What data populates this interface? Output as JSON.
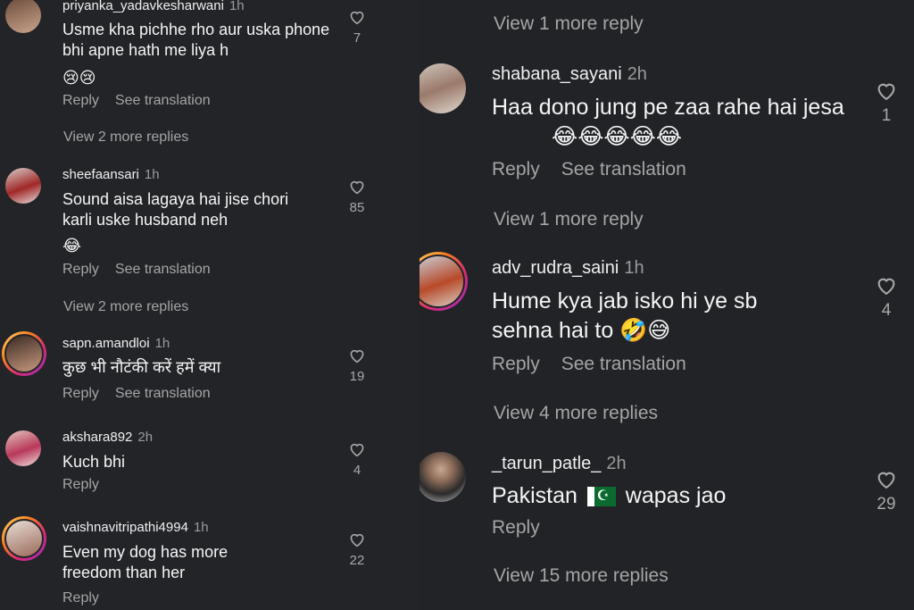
{
  "left": {
    "comments": [
      {
        "username": "priyanka_yadavkesharwani",
        "time": "1h",
        "text": "Usme kha pichhe rho aur uska phone bhi apne hath me liya h",
        "emoji": "😢😢",
        "reply": "Reply",
        "translate": "See translation",
        "likes": "7",
        "more": "View 2 more replies"
      },
      {
        "username": "sheefaansari",
        "time": "1h",
        "text": "Sound aisa lagaya hai jise chori karli uske husband neh",
        "emoji": "😂",
        "reply": "Reply",
        "translate": "See translation",
        "likes": "85",
        "more": "View 2 more replies"
      },
      {
        "username": "sapn.amandloi",
        "time": "1h",
        "text": "कुछ भी नौटंकी करें हमें क्या",
        "reply": "Reply",
        "translate": "See translation",
        "likes": "19"
      },
      {
        "username": "akshara892",
        "time": "2h",
        "text": "Kuch bhi",
        "reply": "Reply",
        "likes": "4"
      },
      {
        "username": "vaishnavitripathi4994",
        "time": "1h",
        "text": "Even my dog has more freedom than her",
        "reply": "Reply",
        "likes": "22"
      }
    ]
  },
  "right": {
    "top_more": "View 1 more reply",
    "comments": [
      {
        "username": "shabana_sayani",
        "time": "2h",
        "text": "Haa dono jung pe zaa rahe hai jesa",
        "emoji": "😂😂😂😂😂",
        "reply": "Reply",
        "translate": "See translation",
        "likes": "1",
        "more": "View 1 more reply"
      },
      {
        "username": "adv_rudra_saini",
        "time": "1h",
        "text": "Hume kya jab isko hi ye sb sehna hai to",
        "emoji": "🤣😅",
        "reply": "Reply",
        "translate": "See translation",
        "likes": "4",
        "more": "View 4 more replies"
      },
      {
        "username": "_tarun_patle_",
        "time": "2h",
        "text_before": "Pakistan",
        "text_after": "wapas jao",
        "reply": "Reply",
        "likes": "29",
        "more": "View 15 more replies"
      }
    ]
  }
}
